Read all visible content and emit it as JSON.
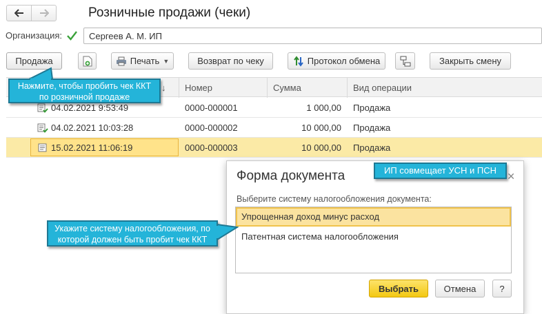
{
  "window": {
    "title": "Розничные продажи (чеки)"
  },
  "nav": {
    "back_icon": "arrow-left-icon",
    "forward_icon": "arrow-right-icon"
  },
  "organization": {
    "label": "Организация:",
    "checked": true,
    "value": "Сергеев А. М. ИП"
  },
  "toolbar": {
    "sale_label": "Продажа",
    "print_label": "Печать",
    "return_label": "Возврат по чеку",
    "exchange_label": "Протокол обмена",
    "close_shift_label": "Закрыть смену"
  },
  "table": {
    "columns": {
      "date_sort": "↓",
      "number": "Номер",
      "sum": "Сумма",
      "operation": "Вид операции"
    },
    "rows": [
      {
        "date": "04.02.2021 9:53:49",
        "number": "0000-000001",
        "sum": "1 000,00",
        "operation": "Продажа"
      },
      {
        "date": "04.02.2021 10:03:28",
        "number": "0000-000002",
        "sum": "10 000,00",
        "operation": "Продажа"
      },
      {
        "date": "15.02.2021 11:06:19",
        "number": "0000-000003",
        "sum": "10 000,00",
        "operation": "Продажа"
      }
    ]
  },
  "callouts": {
    "sale_hint_line1": "Нажмите, чтобы пробить чек ККТ",
    "sale_hint_line2": "по розничной продаже",
    "tax_hint_line1": "Укажите систему налогообложения, по",
    "tax_hint_line2": "которой должен быть пробит чек ККТ",
    "ip_hint": "ИП совмещает УСН и ПСН"
  },
  "dialog": {
    "title": "Форма документа",
    "prompt": "Выберите систему налогообложения документа:",
    "options": [
      "Упрощенная доход минус расход",
      "Патентная система налогообложения"
    ],
    "selected_index": 0,
    "choose_label": "Выбрать",
    "cancel_label": "Отмена",
    "help_label": "?"
  },
  "colors": {
    "accent": "#f3c812",
    "callout": "#24b4d9",
    "selection": "#fbeaa6"
  }
}
